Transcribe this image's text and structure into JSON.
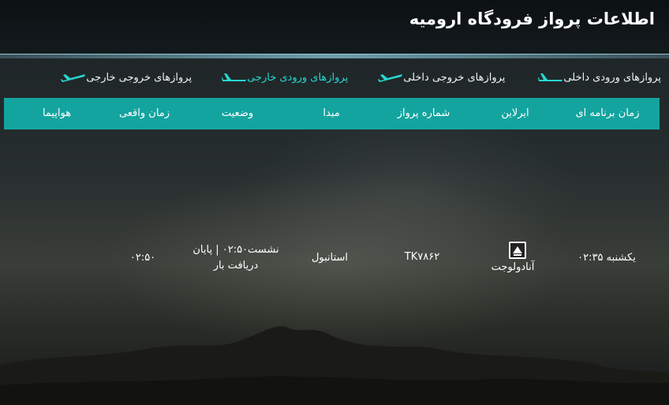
{
  "header": {
    "title": "اطلاعات پرواز فرودگاه ارومیه"
  },
  "tabs": [
    {
      "label": "پروازهای ورودی داخلی",
      "icon": "plane-landing-icon",
      "active": false
    },
    {
      "label": "پروازهای خروجی داخلی",
      "icon": "plane-takeoff-icon",
      "active": false
    },
    {
      "label": "پروازهای ورودی خارجی",
      "icon": "plane-landing-icon",
      "active": true
    },
    {
      "label": "پروازهای خروجی خارجی",
      "icon": "plane-takeoff-icon",
      "active": false
    }
  ],
  "columns": [
    "زمان برنامه ای",
    "ایرلاین",
    "شماره پرواز",
    "مبدا",
    "وضعیت",
    "زمان واقعی",
    "هواپیما"
  ],
  "rows": [
    {
      "scheduled": "یکشنبه ۰۲:۳۵",
      "airline": "آنادولوجت",
      "airline_logo_icon": "anadolujet-logo-icon",
      "flight_number": "TK۷۸۶۲",
      "origin": "استانبول",
      "status_line1": "نشست۰۲:۵۰ | پایان",
      "status_line2": "دریافت بار",
      "actual": "۰۲:۵۰",
      "aircraft": ""
    }
  ],
  "colors": {
    "accent": "#14a49f",
    "active_tab": "#27d7d0",
    "header_bg": "#0c1113",
    "plane_icon": "#27d7d0"
  }
}
